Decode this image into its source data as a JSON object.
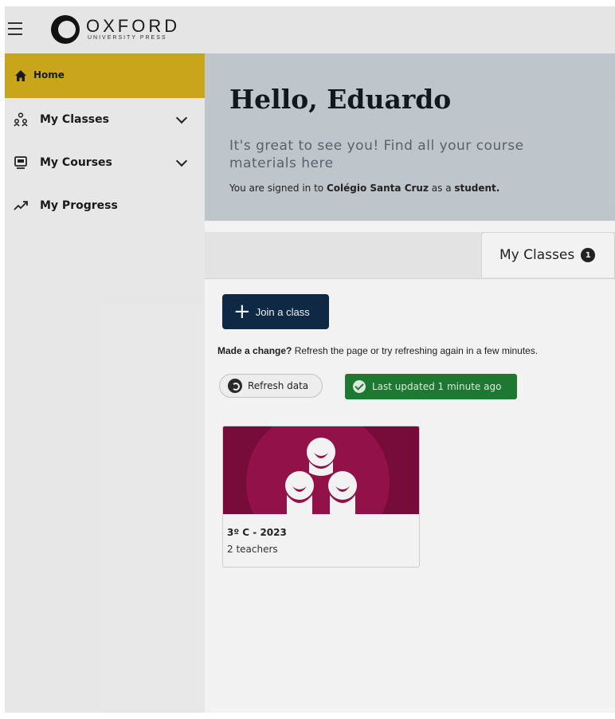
{
  "header": {
    "brand_main": "OXFORD",
    "brand_sub": "UNIVERSITY PRESS"
  },
  "sidebar": {
    "items": [
      {
        "label": "Home",
        "icon": "home-icon",
        "active": true
      },
      {
        "label": "My Classes",
        "icon": "classes-icon",
        "expandable": true
      },
      {
        "label": "My Courses",
        "icon": "courses-icon",
        "expandable": true
      },
      {
        "label": "My Progress",
        "icon": "progress-icon"
      }
    ]
  },
  "hero": {
    "title": "Hello, Eduardo",
    "subtitle": "It's great to see you! Find all your course materials here",
    "signed_prefix": "You are signed in to ",
    "school": "Colégio Santa Cruz",
    "signed_mid": " as a ",
    "role": "student."
  },
  "tabs": {
    "label": "My Classes",
    "count": "1"
  },
  "actions": {
    "join_label": "Join a class",
    "change_bold": "Made a change?",
    "change_text": " Refresh the page or try refreshing again in a few minutes.",
    "refresh_label": "Refresh data",
    "updated_label": "Last updated 1 minute ago"
  },
  "classes": [
    {
      "name": "3º C - 2023",
      "teachers": "2 teachers"
    }
  ],
  "colors": {
    "accent": "#d4ae1c",
    "navy": "#0e2a47",
    "success": "#1d7f32",
    "card": "#7d0a3c"
  }
}
